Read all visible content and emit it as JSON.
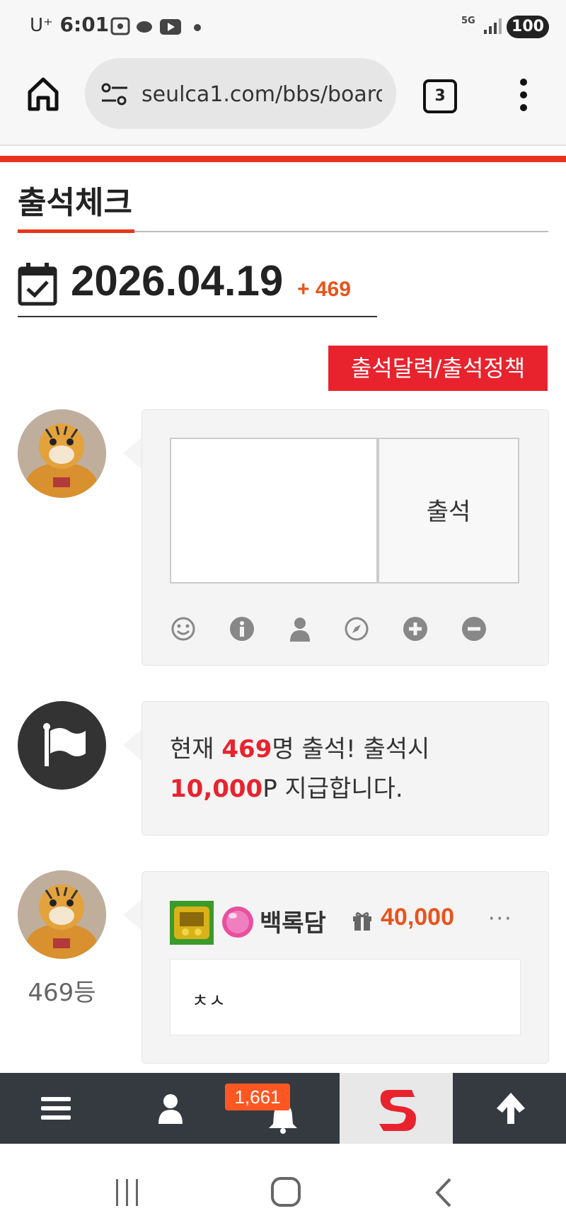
{
  "status_bar": {
    "carrier": "U⁺",
    "time": "6:01",
    "network": "5G",
    "battery": "100"
  },
  "browser": {
    "url": "seulca1.com/bbs/board.",
    "tab_count": "3"
  },
  "page": {
    "title": "출석체크",
    "date": "2026.04.19",
    "date_plus": "+ 469",
    "calendar_button": "출석달력/출석정책"
  },
  "attendance_form": {
    "comment_value": "",
    "submit_label": "출석",
    "tools": [
      "smile-icon",
      "info-icon",
      "user-icon",
      "compass-icon",
      "plus-circle-icon",
      "minus-circle-icon"
    ]
  },
  "notice": {
    "prefix": "현재 ",
    "count": "469",
    "middle": "명 출석! 출석시",
    "points": "10,000",
    "suffix": "P 지급합니다."
  },
  "entry": {
    "username": "백록담",
    "points": "40,000",
    "more": "···",
    "comment": "ㅊㅅ",
    "rank": "469등"
  },
  "bottom_nav": {
    "notification_badge": "1,661",
    "items": [
      "menu-icon",
      "user-icon",
      "bell-icon",
      "site-logo",
      "arrow-up-icon"
    ]
  },
  "colors": {
    "accent": "#e8341c",
    "button_red": "#e8232e",
    "points_orange": "#e8541c",
    "nav_dark": "#343a40"
  }
}
